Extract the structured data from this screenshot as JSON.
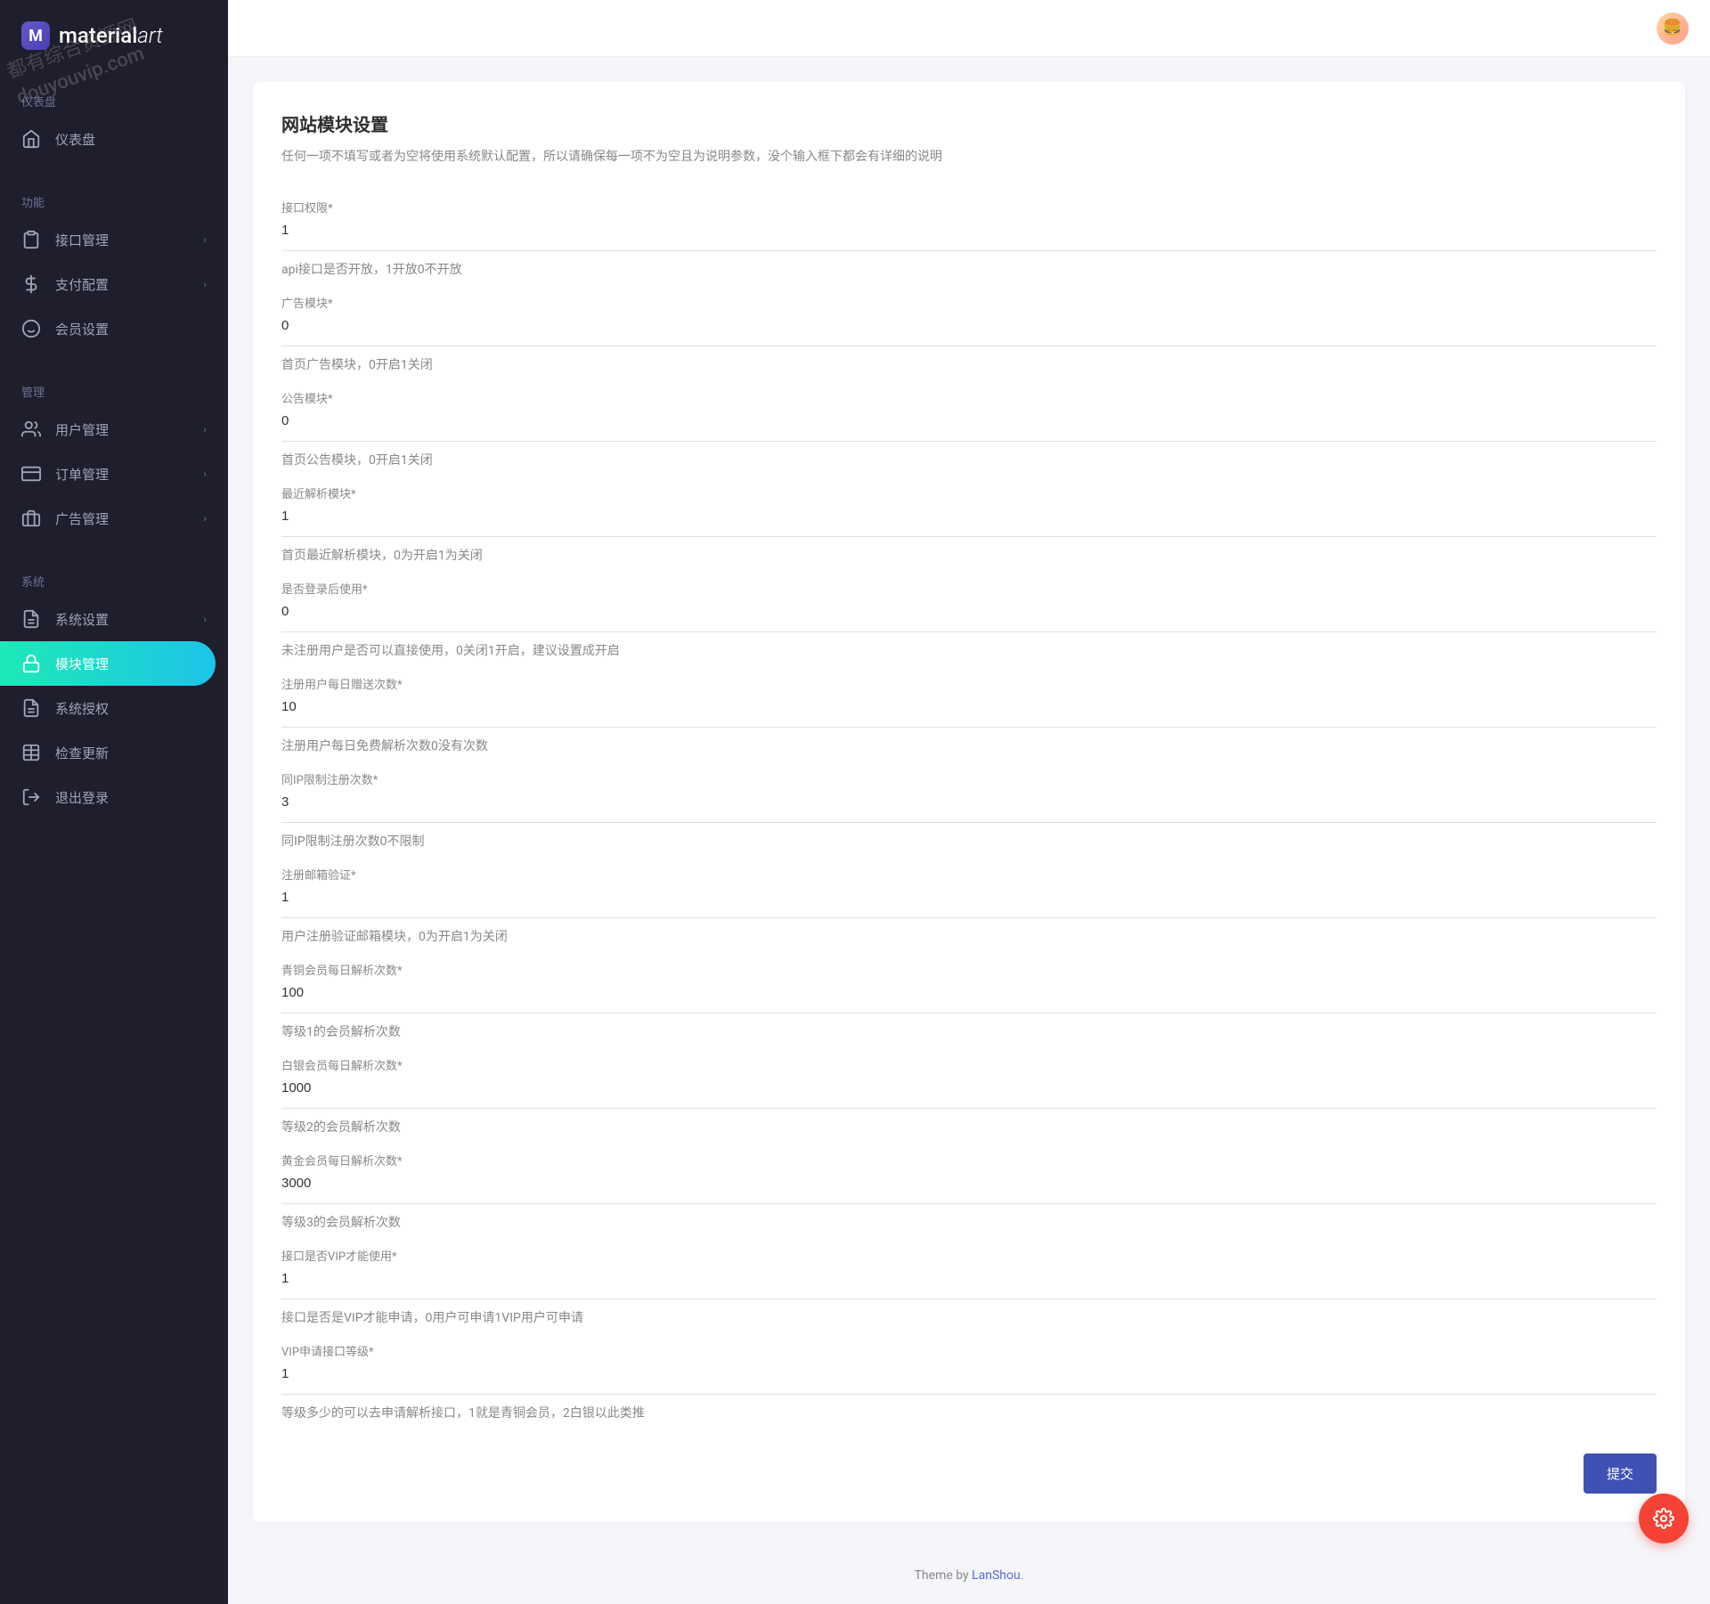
{
  "brand": {
    "prefix": "material",
    "suffix": "art"
  },
  "watermark": {
    "line1": "都有综合资源网",
    "line2": "douyouvip.com"
  },
  "sidebar": {
    "sections": [
      {
        "heading": "仪表盘",
        "items": [
          {
            "id": "dashboard",
            "label": "仪表盘",
            "icon": "home",
            "chevron": false
          }
        ]
      },
      {
        "heading": "功能",
        "items": [
          {
            "id": "api-mgmt",
            "label": "接口管理",
            "icon": "clipboard",
            "chevron": true
          },
          {
            "id": "payment",
            "label": "支付配置",
            "icon": "dollar",
            "chevron": true
          },
          {
            "id": "member",
            "label": "会员设置",
            "icon": "smile",
            "chevron": false
          }
        ]
      },
      {
        "heading": "管理",
        "items": [
          {
            "id": "users",
            "label": "用户管理",
            "icon": "users",
            "chevron": true
          },
          {
            "id": "orders",
            "label": "订单管理",
            "icon": "card",
            "chevron": true
          },
          {
            "id": "ads",
            "label": "广告管理",
            "icon": "badge",
            "chevron": true
          }
        ]
      },
      {
        "heading": "系统",
        "items": [
          {
            "id": "system",
            "label": "系统设置",
            "icon": "doc",
            "chevron": true
          },
          {
            "id": "modules",
            "label": "模块管理",
            "icon": "lock",
            "chevron": false,
            "active": true
          },
          {
            "id": "license",
            "label": "系统授权",
            "icon": "doc",
            "chevron": false
          },
          {
            "id": "update",
            "label": "检查更新",
            "icon": "table",
            "chevron": false
          },
          {
            "id": "logout",
            "label": "退出登录",
            "icon": "exit",
            "chevron": false
          }
        ]
      }
    ]
  },
  "page": {
    "title": "网站模块设置",
    "subtitle": "任何一项不填写或者为空将使用系统默认配置，所以请确保每一项不为空且为说明参数，没个输入框下都会有详细的说明"
  },
  "fields": [
    {
      "label": "接口权限*",
      "value": "1",
      "hint": "api接口是否开放，1开放0不开放"
    },
    {
      "label": "广告模块*",
      "value": "0",
      "hint": "首页广告模块，0开启1关闭"
    },
    {
      "label": "公告模块*",
      "value": "0",
      "hint": "首页公告模块，0开启1关闭"
    },
    {
      "label": "最近解析模块*",
      "value": "1",
      "hint": "首页最近解析模块，0为开启1为关闭"
    },
    {
      "label": "是否登录后使用*",
      "value": "0",
      "hint": "未注册用户是否可以直接使用，0关闭1开启，建议设置成开启"
    },
    {
      "label": "注册用户每日赠送次数*",
      "value": "10",
      "hint": "注册用户每日免费解析次数0没有次数"
    },
    {
      "label": "同IP限制注册次数*",
      "value": "3",
      "hint": "同IP限制注册次数0不限制"
    },
    {
      "label": "注册邮箱验证*",
      "value": "1",
      "hint": "用户注册验证邮箱模块，0为开启1为关闭"
    },
    {
      "label": "青铜会员每日解析次数*",
      "value": "100",
      "hint": "等级1的会员解析次数"
    },
    {
      "label": "白银会员每日解析次数*",
      "value": "1000",
      "hint": "等级2的会员解析次数"
    },
    {
      "label": "黄金会员每日解析次数*",
      "value": "3000",
      "hint": "等级3的会员解析次数"
    },
    {
      "label": "接口是否VIP才能使用*",
      "value": "1",
      "hint": "接口是否是VIP才能申请，0用户可申请1VIP用户可申请"
    },
    {
      "label": "VIP申请接口等级*",
      "value": "1",
      "hint": "等级多少的可以去申请解析接口，1就是青铜会员，2白银以此类推"
    }
  ],
  "submit": "提交",
  "footer": {
    "prefix": "Theme by ",
    "link": "LanShou",
    "suffix": "."
  }
}
